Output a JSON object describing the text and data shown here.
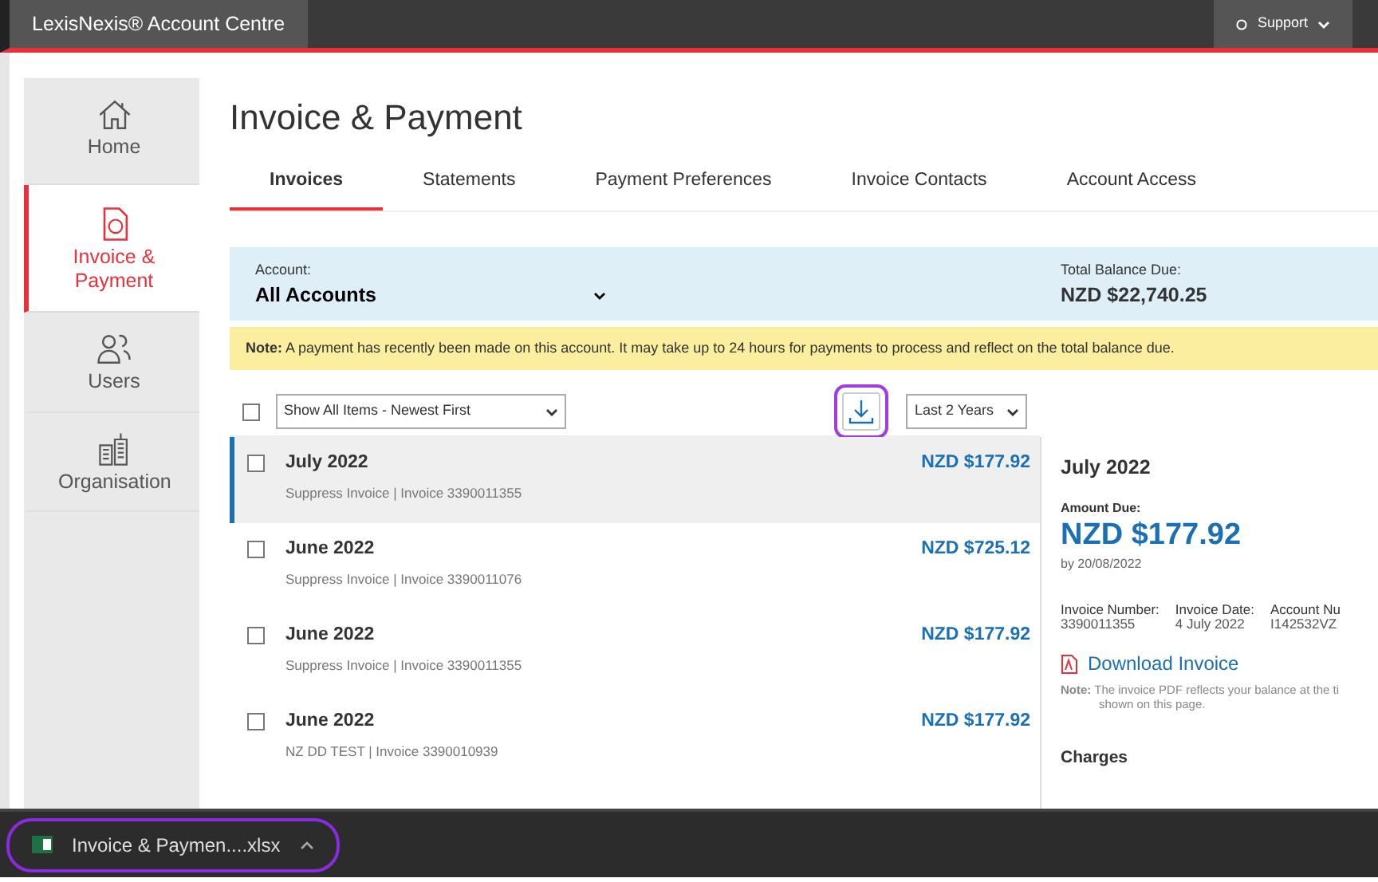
{
  "header": {
    "title": "LexisNexis® Account Centre",
    "support": "Support"
  },
  "sidebar": {
    "items": [
      {
        "label": "Home",
        "selected": false
      },
      {
        "label": "Invoice & Payment",
        "selected": true
      },
      {
        "label": "Users",
        "selected": false
      },
      {
        "label": "Organisation",
        "selected": false
      }
    ]
  },
  "page_title": "Invoice & Payment",
  "tabs": [
    {
      "label": "Invoices",
      "selected": true
    },
    {
      "label": "Statements",
      "selected": false
    },
    {
      "label": "Payment Preferences",
      "selected": false
    },
    {
      "label": "Invoice Contacts",
      "selected": false
    },
    {
      "label": "Account Access",
      "selected": false
    }
  ],
  "account": {
    "label": "Account:",
    "value": "All Accounts",
    "balance_label": "Total Balance Due:",
    "balance": "NZD $22,740.25"
  },
  "note": {
    "text": "**Note:** A payment has recently been made on this account. It may take up to 24 hours for payments to process and reflect on the total balance due."
  },
  "toolbar": {
    "select_all_checked": false,
    "sort": "Show All Items - Newest First",
    "download_highlighted": true,
    "period": "Last 2 Years"
  },
  "invoices": [
    {
      "month": "July 2022",
      "detail": "Suppress Invoice | Invoice 3390011355",
      "amount": "NZD $177.92",
      "checked": false,
      "selected": true
    },
    {
      "month": "June 2022",
      "detail": "Suppress Invoice | Invoice 3390011076",
      "amount": "NZD $725.12",
      "checked": false,
      "selected": false
    },
    {
      "month": "June 2022",
      "detail": "Suppress Invoice | Invoice 3390011355",
      "amount": "NZD $177.92",
      "checked": false,
      "selected": false
    },
    {
      "month": "June 2022",
      "detail": "NZ DD TEST | Invoice 3390010939",
      "amount": "NZD $177.92",
      "checked": false,
      "selected": false
    }
  ],
  "detail": {
    "title": "July 2022",
    "amount_label": "Amount Due:",
    "amount": "NZD $177.92",
    "due": "by 20/08/2022",
    "fields": [
      {
        "label": "Invoice Number:",
        "value": "3390011355"
      },
      {
        "label": "Invoice Date:",
        "value": "4 July 2022"
      },
      {
        "label": "Account Nu",
        "value": "I142532VZ"
      }
    ],
    "download": "Download Invoice",
    "note": "**Note:** The invoice PDF reflects your balance at the ti",
    "note_line2": "shown on this page.",
    "charges": "Charges"
  },
  "download_bar": {
    "file": "Invoice & Paymen....xlsx",
    "highlighted": true
  }
}
